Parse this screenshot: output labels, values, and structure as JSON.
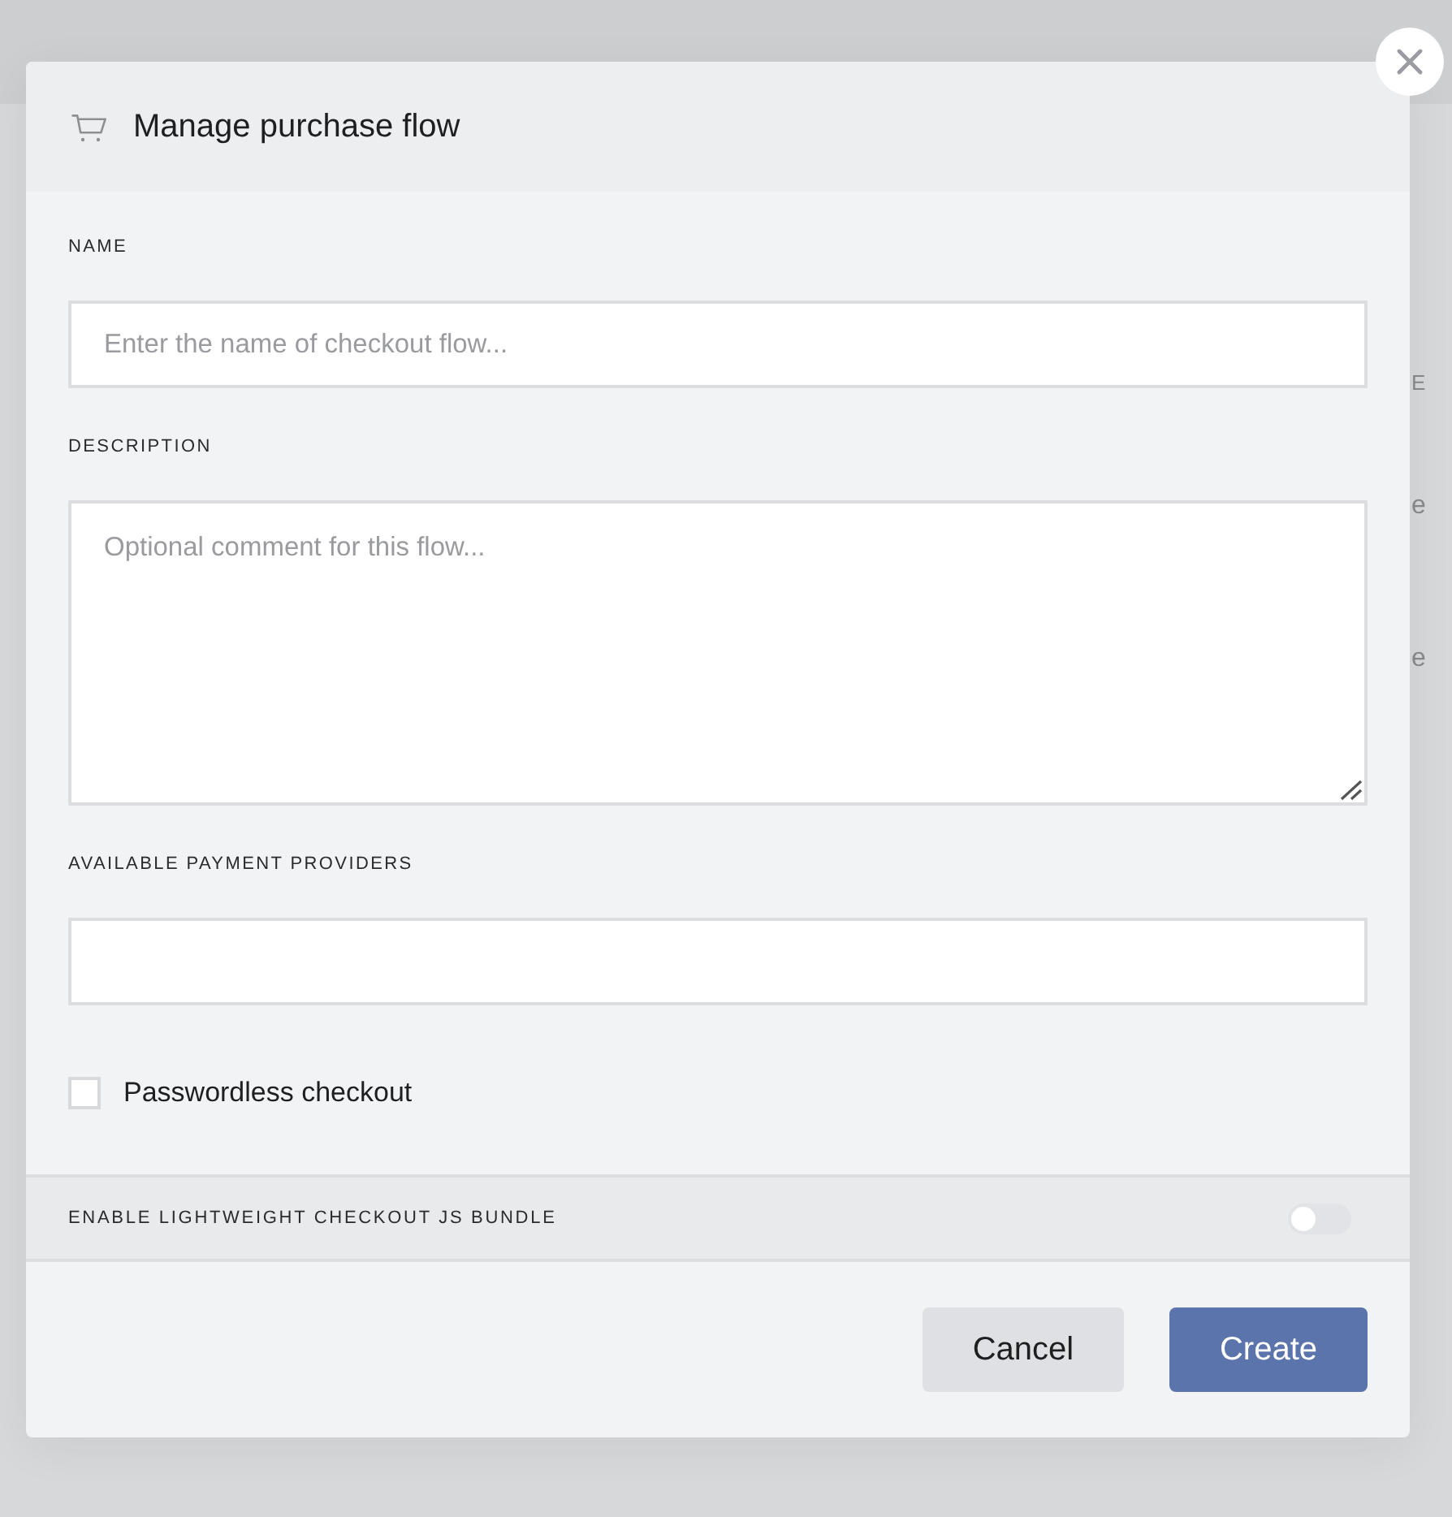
{
  "background_fragments": [
    "E",
    "e",
    "e"
  ],
  "dialog": {
    "title": "Manage purchase flow",
    "fields": [
      {
        "kind": "input",
        "label": "NAME",
        "placeholder": "Enter the name of checkout flow..."
      },
      {
        "kind": "textarea",
        "label": "DESCRIPTION",
        "placeholder": "Optional comment for this flow..."
      },
      {
        "kind": "input",
        "label": "AVAILABLE PAYMENT PROVIDERS"
      }
    ],
    "checkbox": {
      "label": "Passwordless checkout",
      "checked": false
    },
    "lightweight_bundle": {
      "label": "ENABLE LIGHTWEIGHT CHECKOUT JS BUNDLE",
      "on": false
    },
    "buttons": [
      {
        "label": "Cancel",
        "kind": "secondary"
      },
      {
        "label": "Create",
        "kind": "primary"
      }
    ]
  }
}
